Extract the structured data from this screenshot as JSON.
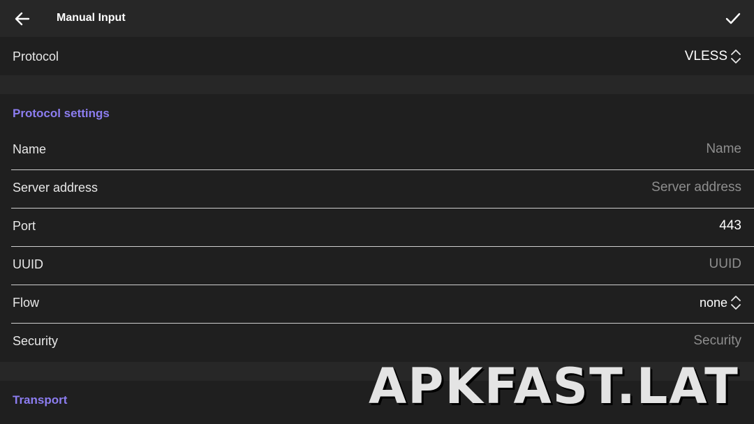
{
  "header": {
    "title": "Manual Input",
    "back_icon": "arrow-left-icon",
    "confirm_icon": "check-icon"
  },
  "protocol": {
    "label": "Protocol",
    "value": "VLESS"
  },
  "protocol_settings": {
    "section_title": "Protocol settings",
    "fields": [
      {
        "label": "Name",
        "placeholder": "Name",
        "value": ""
      },
      {
        "label": "Server address",
        "placeholder": "Server address",
        "value": ""
      },
      {
        "label": "Port",
        "placeholder": "",
        "value": "443"
      },
      {
        "label": "UUID",
        "placeholder": "UUID",
        "value": ""
      },
      {
        "label": "Flow",
        "value": "none"
      },
      {
        "label": "Security",
        "placeholder": "Security",
        "value": ""
      }
    ]
  },
  "transport": {
    "section_title": "Transport"
  },
  "watermark": "APKFAST.LAT",
  "colors": {
    "accent": "#8c7df0",
    "background": "#1f1f1f",
    "bar": "#272727",
    "placeholder": "#8e8e8e"
  }
}
